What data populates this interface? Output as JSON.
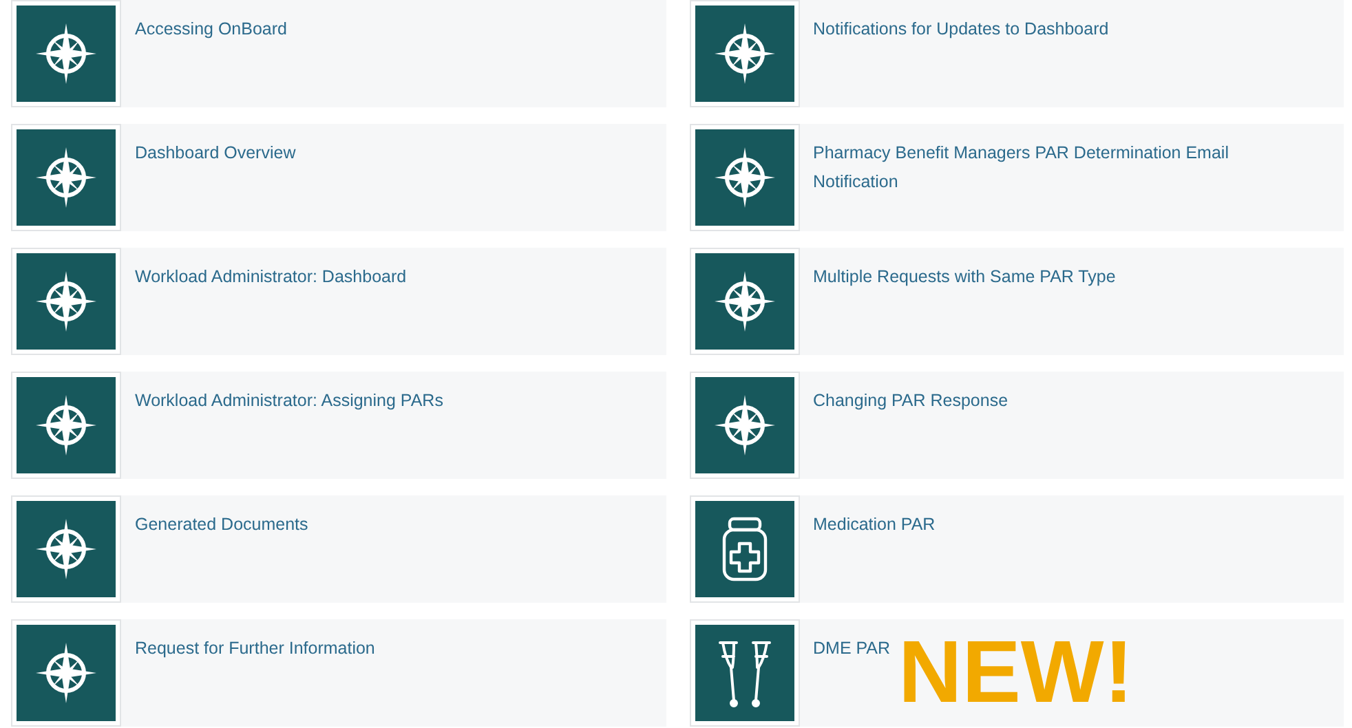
{
  "columns": [
    {
      "items": [
        {
          "title": "Accessing OnBoard",
          "kind": "compass"
        },
        {
          "title": "Dashboard Overview",
          "kind": "compass"
        },
        {
          "title": "Workload Administrator: Dashboard",
          "kind": "compass"
        },
        {
          "title": "Workload Administrator: Assigning PARs",
          "kind": "compass"
        },
        {
          "title": "Generated Documents",
          "kind": "compass"
        },
        {
          "title": "Request for Further Information",
          "kind": "compass"
        }
      ]
    },
    {
      "items": [
        {
          "title": "Notifications for Updates to Dashboard",
          "kind": "compass"
        },
        {
          "title": "Pharmacy Benefit Managers PAR Determination Email Notification",
          "kind": "compass"
        },
        {
          "title": "Multiple Requests with Same PAR Type",
          "kind": "compass"
        },
        {
          "title": "Changing PAR Response",
          "kind": "compass"
        },
        {
          "title": "Medication PAR",
          "kind": "jar"
        },
        {
          "title": "DME PAR",
          "kind": "crutches",
          "badge": "NEW!"
        }
      ]
    }
  ]
}
